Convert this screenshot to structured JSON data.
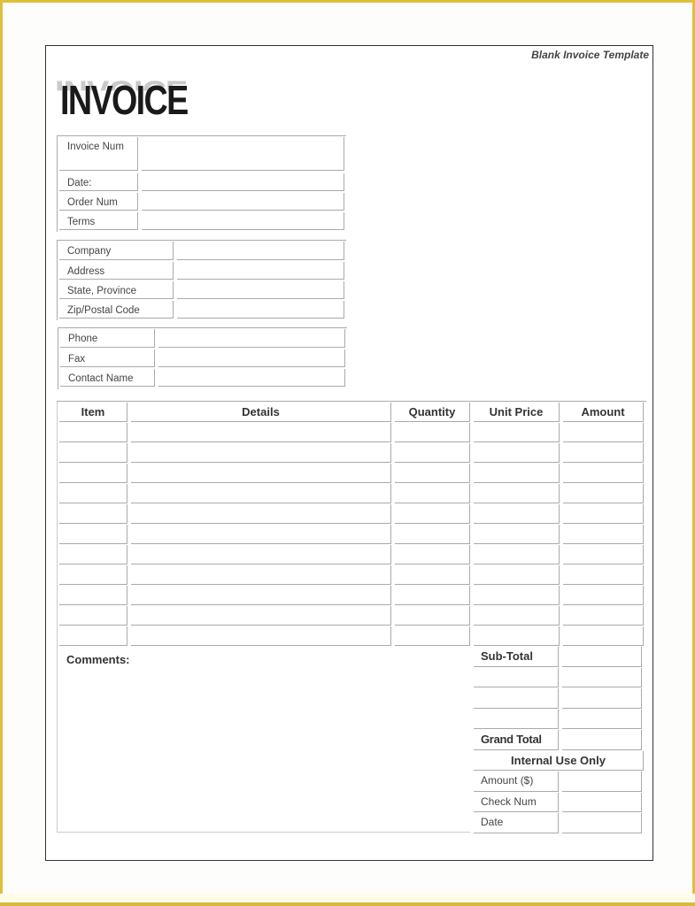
{
  "template_title": "Blank Invoice Template",
  "invoice_heading": "INVOICE",
  "invoice_info": [
    {
      "label": "Invoice Num",
      "value": ""
    },
    {
      "label": "Date:",
      "value": ""
    },
    {
      "label": "Order Num",
      "value": ""
    },
    {
      "label": "Terms",
      "value": ""
    }
  ],
  "company_info": [
    {
      "label": "Company",
      "value": ""
    },
    {
      "label": "Address",
      "value": ""
    },
    {
      "label": "State, Province",
      "value": ""
    },
    {
      "label": "Zip/Postal Code",
      "value": ""
    }
  ],
  "contact_info": [
    {
      "label": "Phone",
      "value": ""
    },
    {
      "label": "Fax",
      "value": ""
    },
    {
      "label": "Contact Name",
      "value": ""
    }
  ],
  "items_table": {
    "columns": [
      "Item",
      "Details",
      "Quantity",
      "Unit Price",
      "Amount"
    ],
    "rows": [
      [
        "",
        "",
        "",
        "",
        ""
      ],
      [
        "",
        "",
        "",
        "",
        ""
      ],
      [
        "",
        "",
        "",
        "",
        ""
      ],
      [
        "",
        "",
        "",
        "",
        ""
      ],
      [
        "",
        "",
        "",
        "",
        ""
      ],
      [
        "",
        "",
        "",
        "",
        ""
      ],
      [
        "",
        "",
        "",
        "",
        ""
      ],
      [
        "",
        "",
        "",
        "",
        ""
      ],
      [
        "",
        "",
        "",
        "",
        ""
      ],
      [
        "",
        "",
        "",
        "",
        ""
      ],
      [
        "",
        "",
        "",
        "",
        ""
      ]
    ]
  },
  "comments_label": "Comments:",
  "totals": {
    "subtotal_label": "Sub-Total",
    "blank_rows": 3,
    "grand_total_label": "Grand Total",
    "internal_use_label": "Internal Use Only",
    "internal_fields": [
      "Amount ($)",
      "Check Num",
      "Date"
    ]
  }
}
